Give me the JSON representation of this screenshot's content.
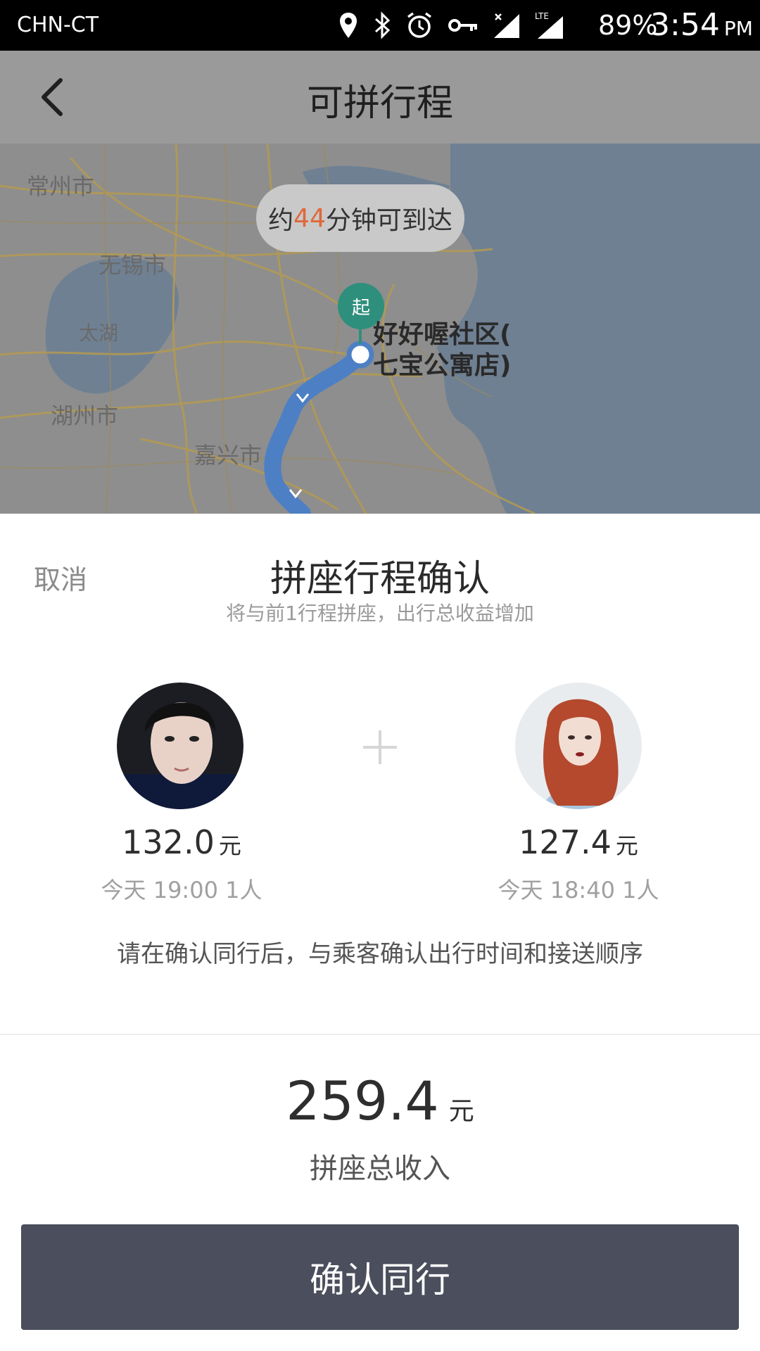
{
  "status_bar": {
    "carrier": "CHN-CT",
    "battery": "89%",
    "time": "3:54",
    "ampm": "PM",
    "icons": [
      "location-icon",
      "bluetooth-icon",
      "alarm-icon",
      "vpn-key-icon",
      "signal-icon",
      "lte-icon"
    ]
  },
  "header": {
    "title": "可拼行程"
  },
  "map": {
    "labels": {
      "changzhou": "常州市",
      "wuxi": "无锡市",
      "taihu": "太湖",
      "huzhou": "湖州市",
      "jiaxing": "嘉兴市"
    },
    "eta": {
      "prefix": "约",
      "minutes": "44",
      "suffix": "分钟可到达"
    },
    "start_marker": "起",
    "location_line1": "好好喔社区(",
    "location_line2": "七宝公寓店)"
  },
  "sheet": {
    "cancel": "取消",
    "title": "拼座行程确认",
    "subtitle": "将与前1行程拼座，出行总收益增加",
    "passengers": [
      {
        "fare": "132.0",
        "unit": "元",
        "trip": "今天 19:00 1人"
      },
      {
        "fare": "127.4",
        "unit": "元",
        "trip": "今天 18:40 1人"
      }
    ],
    "note": "请在确认同行后，与乘客确认出行时间和接送顺序",
    "total_amount": "259.4",
    "total_unit": "元",
    "total_label": "拼座总收入",
    "confirm_button": "确认同行"
  },
  "colors": {
    "accent_orange": "#e0673a",
    "start_pin": "#2e8f7c",
    "button_bg": "#4b4e5c",
    "route": "#4d7fc4"
  }
}
